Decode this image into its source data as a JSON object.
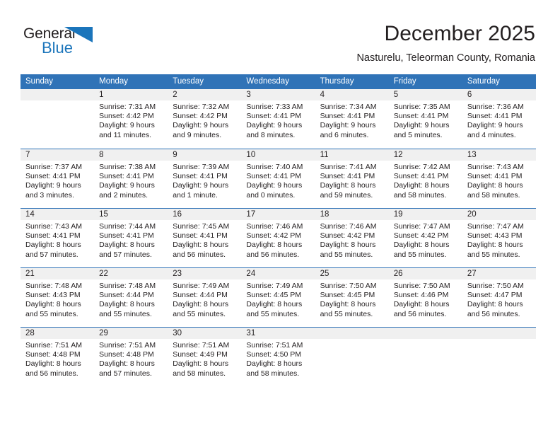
{
  "brand": {
    "name_part1": "General",
    "name_part2": "Blue",
    "triangle_icon": "blue-triangle-icon",
    "colors": {
      "dark": "#231f20",
      "blue": "#1b75bb",
      "header_blue": "#3073b7",
      "band_gray": "#f0f0f0"
    }
  },
  "header": {
    "title": "December 2025",
    "subtitle": "Nasturelu, Teleorman County, Romania"
  },
  "calendar": {
    "weekdays": [
      "Sunday",
      "Monday",
      "Tuesday",
      "Wednesday",
      "Thursday",
      "Friday",
      "Saturday"
    ],
    "weeks": [
      [
        {
          "day": "",
          "sunrise": "",
          "sunset": "",
          "daylight1": "",
          "daylight2": "",
          "empty": true
        },
        {
          "day": "1",
          "sunrise": "Sunrise: 7:31 AM",
          "sunset": "Sunset: 4:42 PM",
          "daylight1": "Daylight: 9 hours",
          "daylight2": "and 11 minutes.",
          "empty": false
        },
        {
          "day": "2",
          "sunrise": "Sunrise: 7:32 AM",
          "sunset": "Sunset: 4:42 PM",
          "daylight1": "Daylight: 9 hours",
          "daylight2": "and 9 minutes.",
          "empty": false
        },
        {
          "day": "3",
          "sunrise": "Sunrise: 7:33 AM",
          "sunset": "Sunset: 4:41 PM",
          "daylight1": "Daylight: 9 hours",
          "daylight2": "and 8 minutes.",
          "empty": false
        },
        {
          "day": "4",
          "sunrise": "Sunrise: 7:34 AM",
          "sunset": "Sunset: 4:41 PM",
          "daylight1": "Daylight: 9 hours",
          "daylight2": "and 6 minutes.",
          "empty": false
        },
        {
          "day": "5",
          "sunrise": "Sunrise: 7:35 AM",
          "sunset": "Sunset: 4:41 PM",
          "daylight1": "Daylight: 9 hours",
          "daylight2": "and 5 minutes.",
          "empty": false
        },
        {
          "day": "6",
          "sunrise": "Sunrise: 7:36 AM",
          "sunset": "Sunset: 4:41 PM",
          "daylight1": "Daylight: 9 hours",
          "daylight2": "and 4 minutes.",
          "empty": false
        }
      ],
      [
        {
          "day": "7",
          "sunrise": "Sunrise: 7:37 AM",
          "sunset": "Sunset: 4:41 PM",
          "daylight1": "Daylight: 9 hours",
          "daylight2": "and 3 minutes.",
          "empty": false
        },
        {
          "day": "8",
          "sunrise": "Sunrise: 7:38 AM",
          "sunset": "Sunset: 4:41 PM",
          "daylight1": "Daylight: 9 hours",
          "daylight2": "and 2 minutes.",
          "empty": false
        },
        {
          "day": "9",
          "sunrise": "Sunrise: 7:39 AM",
          "sunset": "Sunset: 4:41 PM",
          "daylight1": "Daylight: 9 hours",
          "daylight2": "and 1 minute.",
          "empty": false
        },
        {
          "day": "10",
          "sunrise": "Sunrise: 7:40 AM",
          "sunset": "Sunset: 4:41 PM",
          "daylight1": "Daylight: 9 hours",
          "daylight2": "and 0 minutes.",
          "empty": false
        },
        {
          "day": "11",
          "sunrise": "Sunrise: 7:41 AM",
          "sunset": "Sunset: 4:41 PM",
          "daylight1": "Daylight: 8 hours",
          "daylight2": "and 59 minutes.",
          "empty": false
        },
        {
          "day": "12",
          "sunrise": "Sunrise: 7:42 AM",
          "sunset": "Sunset: 4:41 PM",
          "daylight1": "Daylight: 8 hours",
          "daylight2": "and 58 minutes.",
          "empty": false
        },
        {
          "day": "13",
          "sunrise": "Sunrise: 7:43 AM",
          "sunset": "Sunset: 4:41 PM",
          "daylight1": "Daylight: 8 hours",
          "daylight2": "and 58 minutes.",
          "empty": false
        }
      ],
      [
        {
          "day": "14",
          "sunrise": "Sunrise: 7:43 AM",
          "sunset": "Sunset: 4:41 PM",
          "daylight1": "Daylight: 8 hours",
          "daylight2": "and 57 minutes.",
          "empty": false
        },
        {
          "day": "15",
          "sunrise": "Sunrise: 7:44 AM",
          "sunset": "Sunset: 4:41 PM",
          "daylight1": "Daylight: 8 hours",
          "daylight2": "and 57 minutes.",
          "empty": false
        },
        {
          "day": "16",
          "sunrise": "Sunrise: 7:45 AM",
          "sunset": "Sunset: 4:41 PM",
          "daylight1": "Daylight: 8 hours",
          "daylight2": "and 56 minutes.",
          "empty": false
        },
        {
          "day": "17",
          "sunrise": "Sunrise: 7:46 AM",
          "sunset": "Sunset: 4:42 PM",
          "daylight1": "Daylight: 8 hours",
          "daylight2": "and 56 minutes.",
          "empty": false
        },
        {
          "day": "18",
          "sunrise": "Sunrise: 7:46 AM",
          "sunset": "Sunset: 4:42 PM",
          "daylight1": "Daylight: 8 hours",
          "daylight2": "and 55 minutes.",
          "empty": false
        },
        {
          "day": "19",
          "sunrise": "Sunrise: 7:47 AM",
          "sunset": "Sunset: 4:42 PM",
          "daylight1": "Daylight: 8 hours",
          "daylight2": "and 55 minutes.",
          "empty": false
        },
        {
          "day": "20",
          "sunrise": "Sunrise: 7:47 AM",
          "sunset": "Sunset: 4:43 PM",
          "daylight1": "Daylight: 8 hours",
          "daylight2": "and 55 minutes.",
          "empty": false
        }
      ],
      [
        {
          "day": "21",
          "sunrise": "Sunrise: 7:48 AM",
          "sunset": "Sunset: 4:43 PM",
          "daylight1": "Daylight: 8 hours",
          "daylight2": "and 55 minutes.",
          "empty": false
        },
        {
          "day": "22",
          "sunrise": "Sunrise: 7:48 AM",
          "sunset": "Sunset: 4:44 PM",
          "daylight1": "Daylight: 8 hours",
          "daylight2": "and 55 minutes.",
          "empty": false
        },
        {
          "day": "23",
          "sunrise": "Sunrise: 7:49 AM",
          "sunset": "Sunset: 4:44 PM",
          "daylight1": "Daylight: 8 hours",
          "daylight2": "and 55 minutes.",
          "empty": false
        },
        {
          "day": "24",
          "sunrise": "Sunrise: 7:49 AM",
          "sunset": "Sunset: 4:45 PM",
          "daylight1": "Daylight: 8 hours",
          "daylight2": "and 55 minutes.",
          "empty": false
        },
        {
          "day": "25",
          "sunrise": "Sunrise: 7:50 AM",
          "sunset": "Sunset: 4:45 PM",
          "daylight1": "Daylight: 8 hours",
          "daylight2": "and 55 minutes.",
          "empty": false
        },
        {
          "day": "26",
          "sunrise": "Sunrise: 7:50 AM",
          "sunset": "Sunset: 4:46 PM",
          "daylight1": "Daylight: 8 hours",
          "daylight2": "and 56 minutes.",
          "empty": false
        },
        {
          "day": "27",
          "sunrise": "Sunrise: 7:50 AM",
          "sunset": "Sunset: 4:47 PM",
          "daylight1": "Daylight: 8 hours",
          "daylight2": "and 56 minutes.",
          "empty": false
        }
      ],
      [
        {
          "day": "28",
          "sunrise": "Sunrise: 7:51 AM",
          "sunset": "Sunset: 4:48 PM",
          "daylight1": "Daylight: 8 hours",
          "daylight2": "and 56 minutes.",
          "empty": false
        },
        {
          "day": "29",
          "sunrise": "Sunrise: 7:51 AM",
          "sunset": "Sunset: 4:48 PM",
          "daylight1": "Daylight: 8 hours",
          "daylight2": "and 57 minutes.",
          "empty": false
        },
        {
          "day": "30",
          "sunrise": "Sunrise: 7:51 AM",
          "sunset": "Sunset: 4:49 PM",
          "daylight1": "Daylight: 8 hours",
          "daylight2": "and 58 minutes.",
          "empty": false
        },
        {
          "day": "31",
          "sunrise": "Sunrise: 7:51 AM",
          "sunset": "Sunset: 4:50 PM",
          "daylight1": "Daylight: 8 hours",
          "daylight2": "and 58 minutes.",
          "empty": false
        },
        {
          "day": "",
          "sunrise": "",
          "sunset": "",
          "daylight1": "",
          "daylight2": "",
          "empty": true
        },
        {
          "day": "",
          "sunrise": "",
          "sunset": "",
          "daylight1": "",
          "daylight2": "",
          "empty": true
        },
        {
          "day": "",
          "sunrise": "",
          "sunset": "",
          "daylight1": "",
          "daylight2": "",
          "empty": true
        }
      ]
    ]
  }
}
